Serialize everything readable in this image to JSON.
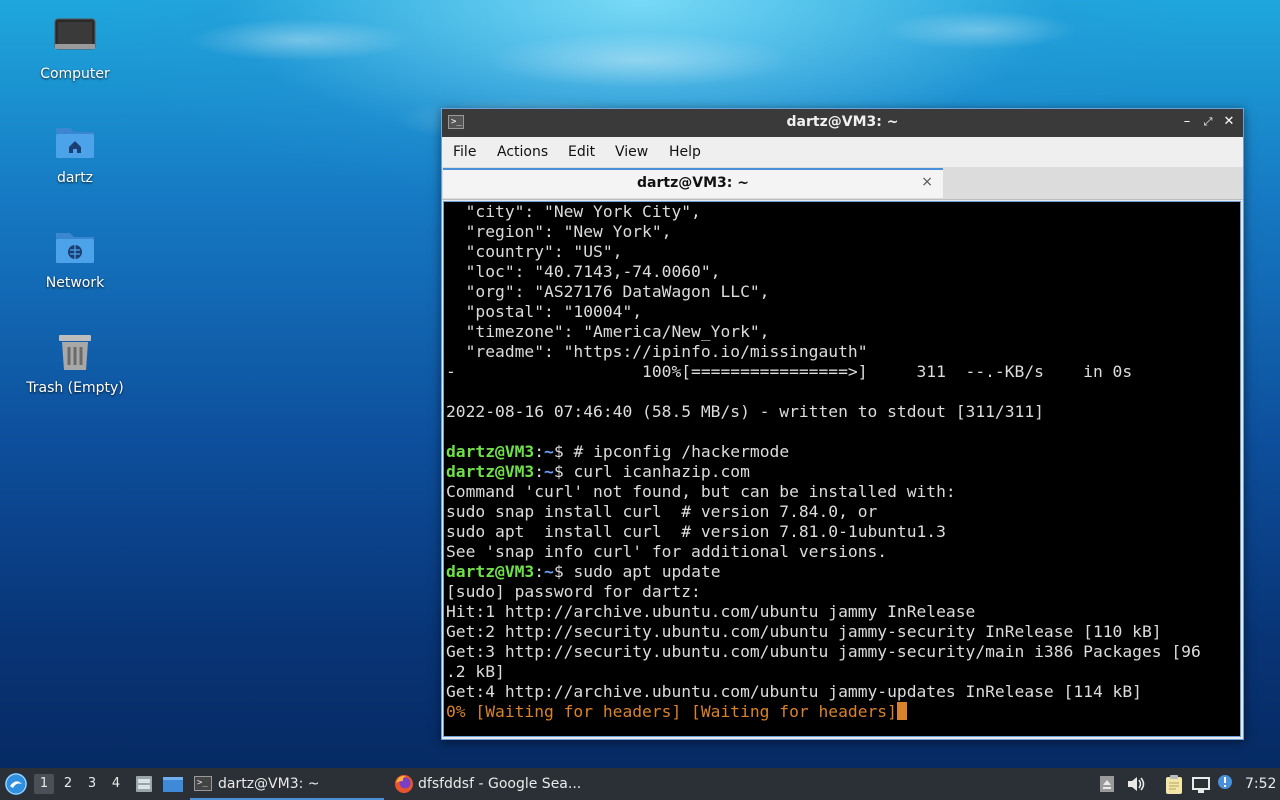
{
  "desktop": {
    "icons": [
      {
        "label": "Computer"
      },
      {
        "label": "dartz"
      },
      {
        "label": "Network"
      },
      {
        "label": "Trash (Empty)"
      }
    ]
  },
  "window": {
    "title": "dartz@VM3: ~",
    "buttons": {
      "minimize": "–",
      "maximize": "⤢",
      "close": "✕"
    },
    "menu": [
      "File",
      "Actions",
      "Edit",
      "View",
      "Help"
    ],
    "tab": {
      "label": "dartz@VM3: ~",
      "close": "×"
    }
  },
  "terminal": {
    "prompt_user": "dartz@VM3",
    "prompt_path": "~",
    "lines": [
      "  \"city\": \"New York City\",",
      "  \"region\": \"New York\",",
      "  \"country\": \"US\",",
      "  \"loc\": \"40.7143,-74.0060\",",
      "  \"org\": \"AS27176 DataWagon LLC\",",
      "  \"postal\": \"10004\",",
      "  \"timezone\": \"America/New_York\",",
      "  \"readme\": \"https://ipinfo.io/missingauth\"",
      "-                   100%[================>]     311  --.-KB/s    in 0s",
      "",
      "2022-08-16 07:46:40 (58.5 MB/s) - written to stdout [311/311]",
      ""
    ],
    "cmd1": " # ipconfig /hackermode",
    "cmd2": " curl icanhazip.com",
    "curl_output": [
      "Command 'curl' not found, but can be installed with:",
      "sudo snap install curl  # version 7.84.0, or",
      "sudo apt  install curl  # version 7.81.0-1ubuntu1.3",
      "See 'snap info curl' for additional versions."
    ],
    "cmd3": " sudo apt update",
    "apt_output": [
      "[sudo] password for dartz:",
      "Hit:1 http://archive.ubuntu.com/ubuntu jammy InRelease",
      "Get:2 http://security.ubuntu.com/ubuntu jammy-security InRelease [110 kB]",
      "Get:3 http://security.ubuntu.com/ubuntu jammy-security/main i386 Packages [96",
      ".2 kB]",
      "Get:4 http://archive.ubuntu.com/ubuntu jammy-updates InRelease [114 kB]"
    ],
    "progress_line": "0% [Waiting for headers] [Waiting for headers]"
  },
  "taskbar": {
    "workspaces": [
      "1",
      "2",
      "3",
      "4"
    ],
    "tasks": [
      {
        "label": "dartz@VM3: ~"
      },
      {
        "label": "dfsfddsf - Google Sea..."
      }
    ],
    "clock": "7:52"
  }
}
